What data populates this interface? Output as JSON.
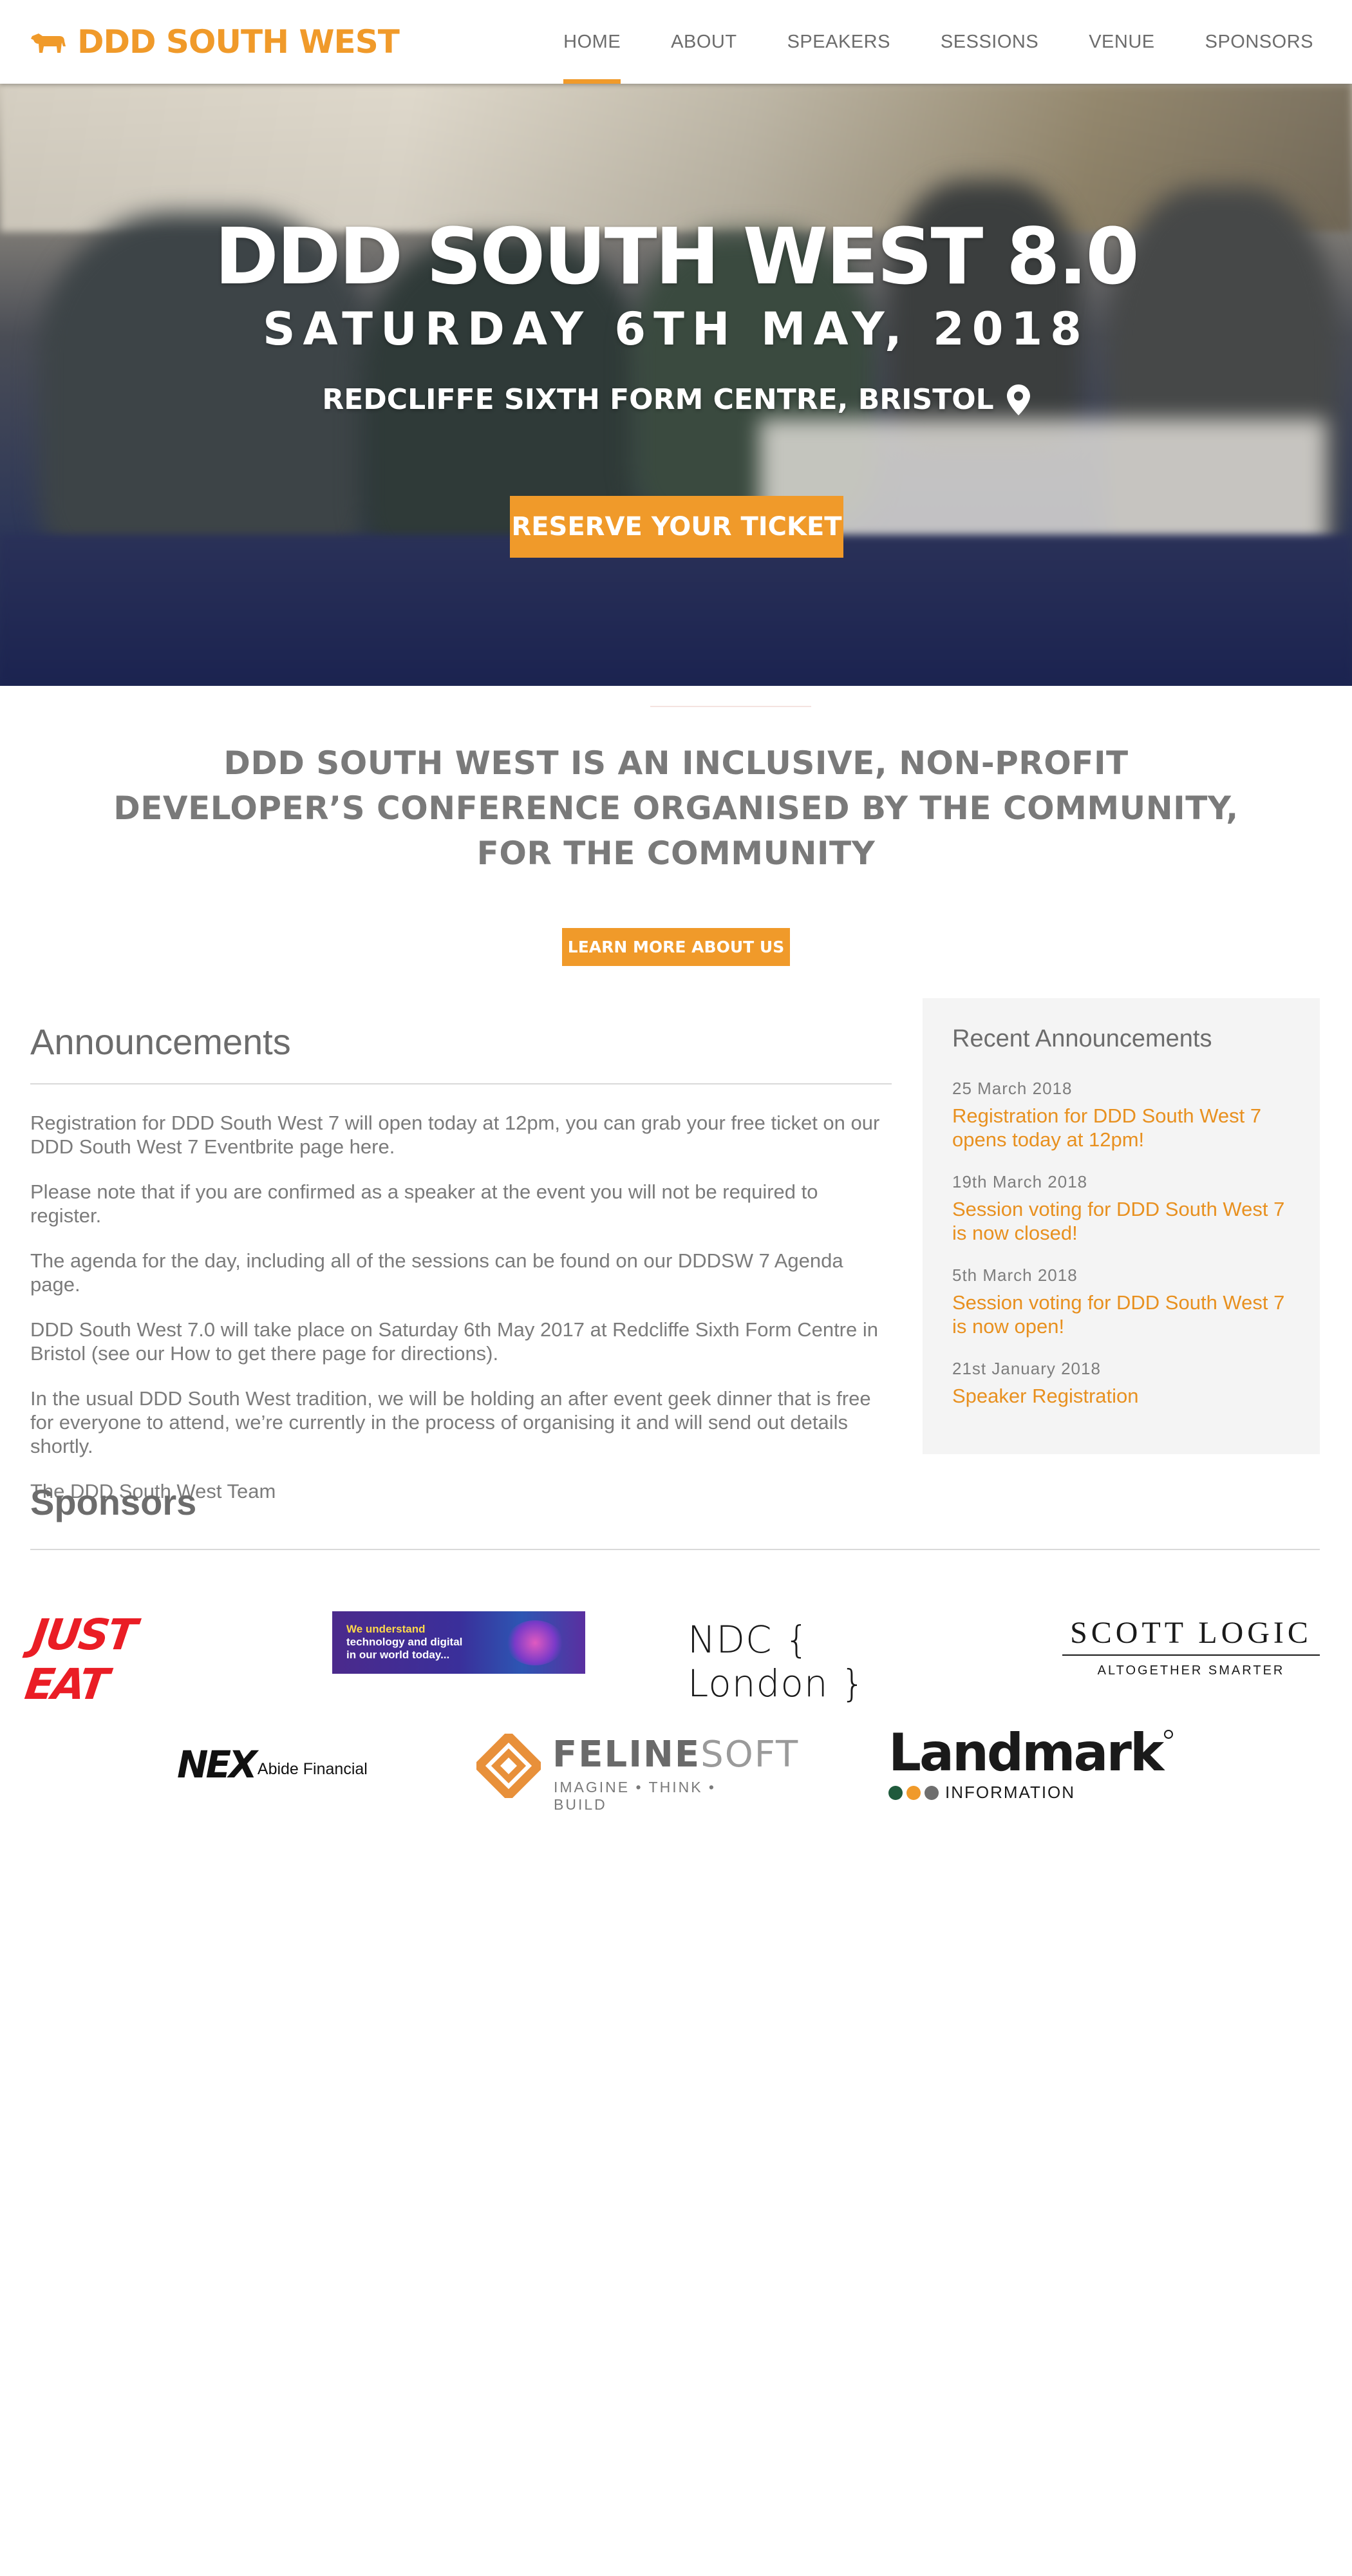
{
  "nav": {
    "brand": "DDD SOUTH WEST",
    "logo_icon": "cow-icon",
    "items": [
      "HOME",
      "ABOUT",
      "SPEAKERS",
      "SESSIONS",
      "VENUE",
      "SPONSORS"
    ],
    "active": "HOME"
  },
  "hero": {
    "title": "DDD SOUTH WEST 8.0",
    "date": "SATURDAY 6TH MAY, 2018",
    "venue": "REDCLIFFE SIXTH FORM CENTRE, BRISTOL",
    "venue_icon": "map-pin-icon",
    "cta": "RESERVE YOUR TICKET"
  },
  "intro": {
    "text": "DDD SOUTH WEST IS AN INCLUSIVE, NON-PROFIT DEVELOPER’S CONFERENCE ORGANISED BY THE COMMUNITY, FOR THE COMMUNITY",
    "cta": "LEARN MORE ABOUT US"
  },
  "announcements": {
    "title": "Announcements",
    "paragraphs": [
      "Registration for DDD South West 7 will open today at 12pm, you can grab your free ticket on our DDD South West 7 Eventbrite page here.",
      "Please note that if you are confirmed as a speaker at the event you will not be required to register.",
      "The agenda for the day, including all of the sessions can be found on our DDDSW 7 Agenda page.",
      "DDD South West 7.0 will take place on Saturday 6th May 2017 at Redcliffe Sixth Form Centre in Bristol (see our How to get there page for directions).",
      "In the usual DDD South West tradition, we will be holding an after event geek dinner that is free for everyone to attend, we’re currently in the process of organising it and will send out details shortly.",
      "The DDD South West Team"
    ]
  },
  "recent": {
    "title": "Recent Announcements",
    "items": [
      {
        "date": "25 March 2018",
        "title": "Registration for DDD South West 7 opens today at 12pm!"
      },
      {
        "date": "19th March 2018",
        "title": "Session voting for DDD South West 7 is now closed!"
      },
      {
        "date": "5th March 2018",
        "title": "Session voting for DDD South West 7 is now open!"
      },
      {
        "date": "21st January 2018",
        "title": "Speaker Registration"
      }
    ]
  },
  "sponsors": {
    "title": "Sponsors",
    "logos": {
      "just_eat": "JUST EAT",
      "banner": [
        "We understand",
        "technology and digital",
        "in our world today..."
      ],
      "ndc": "NDC { London }",
      "scott_logic_1": "SCOTT LOGIC",
      "scott_logic_2": "ALTOGETHER SMARTER",
      "nex_1": "NEX",
      "nex_2": "Abide Financial",
      "feline_1": "FELINE",
      "feline_2": "SOFT",
      "feline_3": "IMAGINE • THINK • BUILD",
      "landmark_1": "Landmark",
      "landmark_2": "INFORMATION"
    }
  },
  "colors": {
    "accent": "#f09a2a",
    "link": "#e8901f",
    "text": "#6f6f6f",
    "panel": "#f4f4f4",
    "just_eat_red": "#ea1d25"
  }
}
